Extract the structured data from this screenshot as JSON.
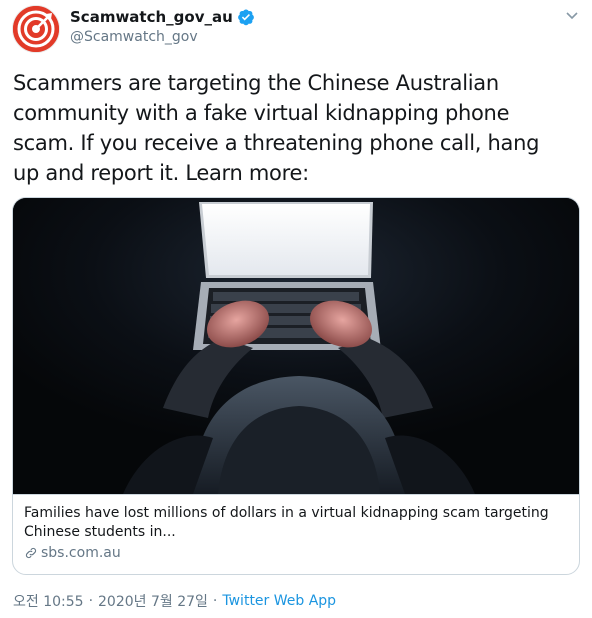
{
  "user": {
    "display_name": "Scamwatch_gov_au",
    "handle": "@Scamwatch_gov",
    "verified": true
  },
  "tweet": {
    "text": "Scammers are targeting the Chinese Australian\ncommunity with a fake virtual kidnapping phone\nscam. If you receive a threatening phone call, hang\nup and report it. Learn more:"
  },
  "card": {
    "title": "Families have lost millions of dollars in a virtual kidnapping scam targeting Chinese students in...",
    "domain": "sbs.com.au"
  },
  "meta": {
    "time": "오전 10:55",
    "date": "2020년 7월 27일",
    "separator": "·",
    "source": "Twitter Web App"
  },
  "colors": {
    "link": "#1b95e0",
    "verified": "#1da1f2",
    "brand_red": "#e23a28",
    "secondary_text": "#657786"
  },
  "icons": {
    "avatar": "target-logo-icon",
    "verified": "verified-badge-icon",
    "caret": "chevron-down-icon",
    "link": "link-icon"
  }
}
